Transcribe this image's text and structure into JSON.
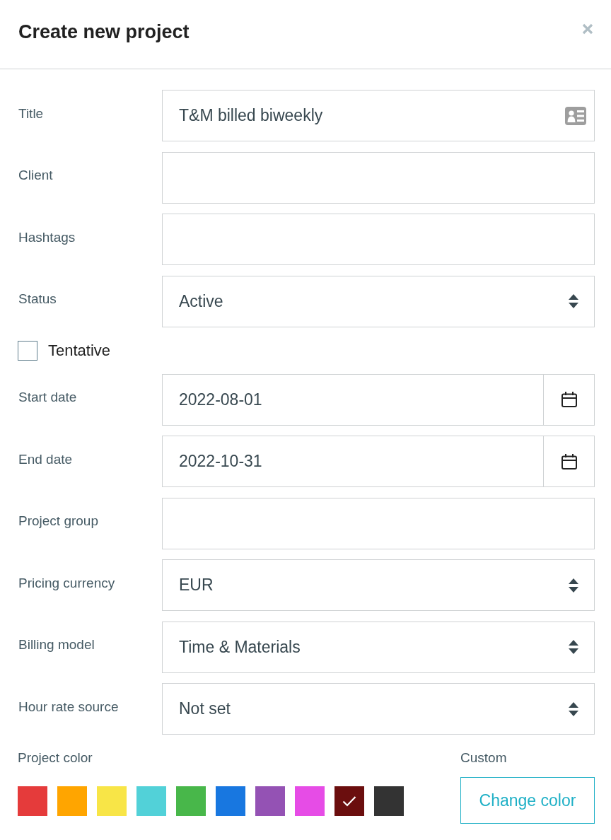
{
  "dialog": {
    "title": "Create new project"
  },
  "fields": [
    {
      "label": "Title",
      "kind": "card_text",
      "value": "T&M billed biweekly"
    },
    {
      "label": "Client",
      "kind": "text"
    },
    {
      "label": "Hashtags",
      "kind": "text"
    },
    {
      "label": "Status",
      "kind": "select",
      "value": "Active"
    },
    {
      "label": "Tentative",
      "kind": "checkbox",
      "checked": false
    },
    {
      "label": "Start date",
      "kind": "date",
      "value": "2022-08-01"
    },
    {
      "label": "End date",
      "kind": "date",
      "value": "2022-10-31"
    },
    {
      "label": "Project group",
      "kind": "text"
    },
    {
      "label": "Pricing currency",
      "kind": "select",
      "value": "EUR"
    },
    {
      "label": "Billing model",
      "kind": "select",
      "value": "Time & Materials"
    },
    {
      "label": "Hour rate source",
      "kind": "select",
      "value": "Not set"
    }
  ],
  "project_color": {
    "label": "Project color",
    "swatches": [
      {
        "color": "#e53b3b",
        "selected": false
      },
      {
        "color": "#ffa500",
        "selected": false
      },
      {
        "color": "#f8e547",
        "selected": false
      },
      {
        "color": "#52d1d8",
        "selected": false
      },
      {
        "color": "#48b74a",
        "selected": false
      },
      {
        "color": "#1877e0",
        "selected": false
      },
      {
        "color": "#9452b4",
        "selected": false
      },
      {
        "color": "#e64ce6",
        "selected": false
      },
      {
        "color": "#6b0e0e",
        "selected": true
      },
      {
        "color": "#333333",
        "selected": false
      }
    ]
  },
  "custom": {
    "label": "Custom",
    "button": "Change color"
  }
}
